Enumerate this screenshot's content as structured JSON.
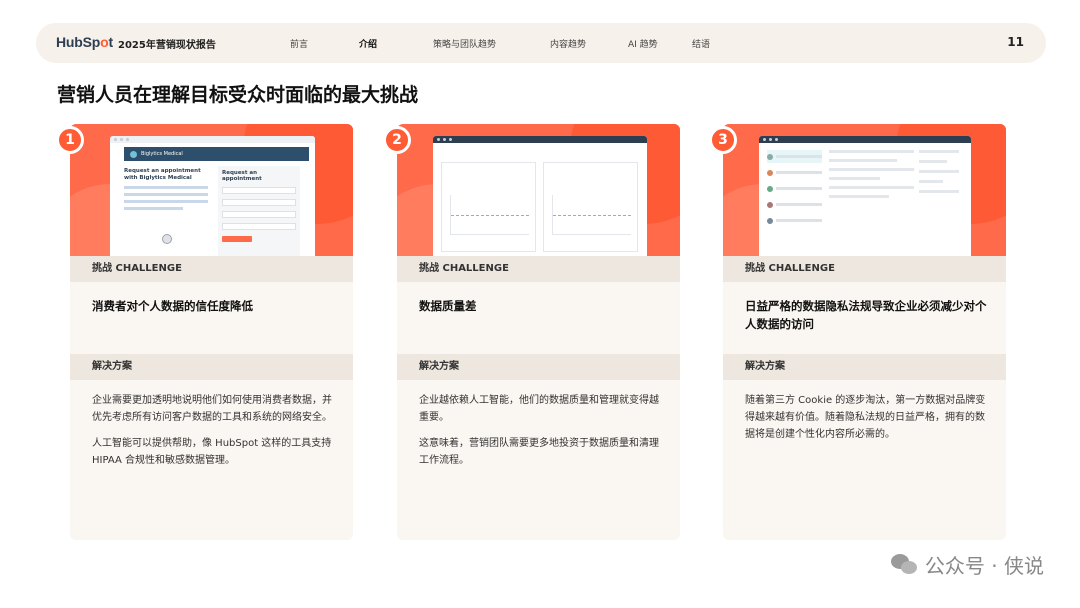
{
  "header": {
    "logo_text_a": "HubSp",
    "logo_text_o": "o",
    "logo_text_b": "t",
    "report_title": "2025年营销现状报告",
    "nav": [
      "前言",
      "介绍",
      "策略与团队趋势",
      "内容趋势",
      "AI 趋势",
      "结语"
    ],
    "active_nav": "介绍",
    "page_number": "11"
  },
  "page_title": "营销人员在理解目标受众时面临的最大挑战",
  "cards": [
    {
      "number": "1",
      "challenge_label": "挑战 CHALLENGE",
      "challenge": "消费者对个人数据的信任度降低",
      "solution_label": "解决方案",
      "solution": [
        "企业需要更加透明地说明他们如何使用消费者数据，并优先考虑所有访问客户数据的工具和系统的网络安全。",
        "人工智能可以提供帮助，像 HubSpot 这样的工具支持 HIPAA 合规性和敏感数据管理。"
      ],
      "mock": {
        "brand": "Biglytics Medical",
        "heading": "Request an appointment with Biglytics Medical",
        "form_title": "Request an appointment"
      }
    },
    {
      "number": "2",
      "challenge_label": "挑战 CHALLENGE",
      "challenge": "数据质量差",
      "solution_label": "解决方案",
      "solution": [
        "企业越依赖人工智能，他们的数据质量和管理就变得越重要。",
        "这意味着，营销团队需要更多地投资于数据质量和清理工作流程。"
      ]
    },
    {
      "number": "3",
      "challenge_label": "挑战 CHALLENGE",
      "challenge": "日益严格的数据隐私法规导致企业必须减少对个人数据的访问",
      "solution_label": "解决方案",
      "solution": [
        "随着第三方 Cookie 的逐步淘汰，第一方数据对品牌变得越来越有价值。随着隐私法规的日益严格，拥有的数据将是创建个性化内容所必需的。"
      ]
    }
  ],
  "watermark": "公众号 · 侠说",
  "colors": {
    "accent": "#ff5c35",
    "card_bg": "#faf6f1",
    "label_bg": "#ede7df",
    "nav_bg": "#f6f1ea"
  }
}
